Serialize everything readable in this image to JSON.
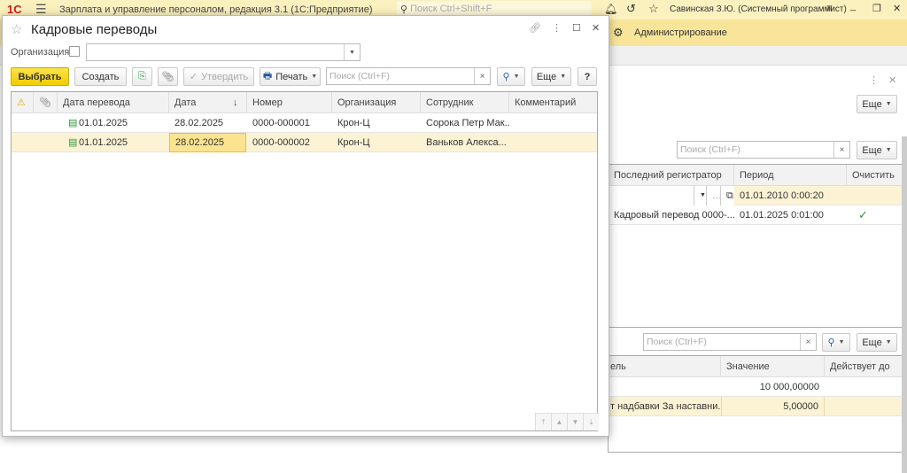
{
  "app": {
    "title": "Зарплата и управление персоналом, редакция 3.1  (1С:Предприятие)",
    "search_placeholder": "Поиск Ctrl+Shift+F",
    "user": "Савинская З.Ю. (Системный программист)",
    "section": "Администрирование",
    "logo": "1С"
  },
  "modal": {
    "title": "Кадровые переводы",
    "org_label": "Организация:",
    "org_value": "",
    "toolbar": {
      "select": "Выбрать",
      "create": "Создать",
      "approve": "Утвердить",
      "print": "Печать",
      "search_placeholder": "Поиск (Ctrl+F)",
      "more": "Еще",
      "help": "?"
    },
    "columns": [
      "Дата перевода",
      "Дата",
      "Номер",
      "Организация",
      "Сотрудник",
      "Комментарий"
    ],
    "rows": [
      {
        "transfer_date": "01.01.2025",
        "date": "28.02.2025",
        "number": "0000-000001",
        "org": "Крон-Ц",
        "employee": "Сорока Петр Мак...",
        "comment": ""
      },
      {
        "transfer_date": "01.01.2025",
        "date": "28.02.2025",
        "number": "0000-000002",
        "org": "Крон-Ц",
        "employee": "Ваньков Алекса...",
        "comment": ""
      }
    ]
  },
  "background": {
    "more": "Еще",
    "search_placeholder": "Поиск (Ctrl+F)",
    "grid1": {
      "columns": [
        "Последний регистратор",
        "Период",
        "Очистить"
      ],
      "rows": [
        {
          "registrar": "",
          "period": "01.01.2010 0:00:20"
        },
        {
          "registrar": "Кадровый перевод 0000-...",
          "period": "01.01.2025 0:01:00"
        }
      ]
    },
    "grid2": {
      "columns": [
        "ель",
        "Значение",
        "Действует до"
      ],
      "rows": [
        {
          "name": "",
          "value": "10 000,00000",
          "until": ""
        },
        {
          "name": "т надбавки За наставни...",
          "value": "5,00000",
          "until": ""
        }
      ]
    }
  }
}
